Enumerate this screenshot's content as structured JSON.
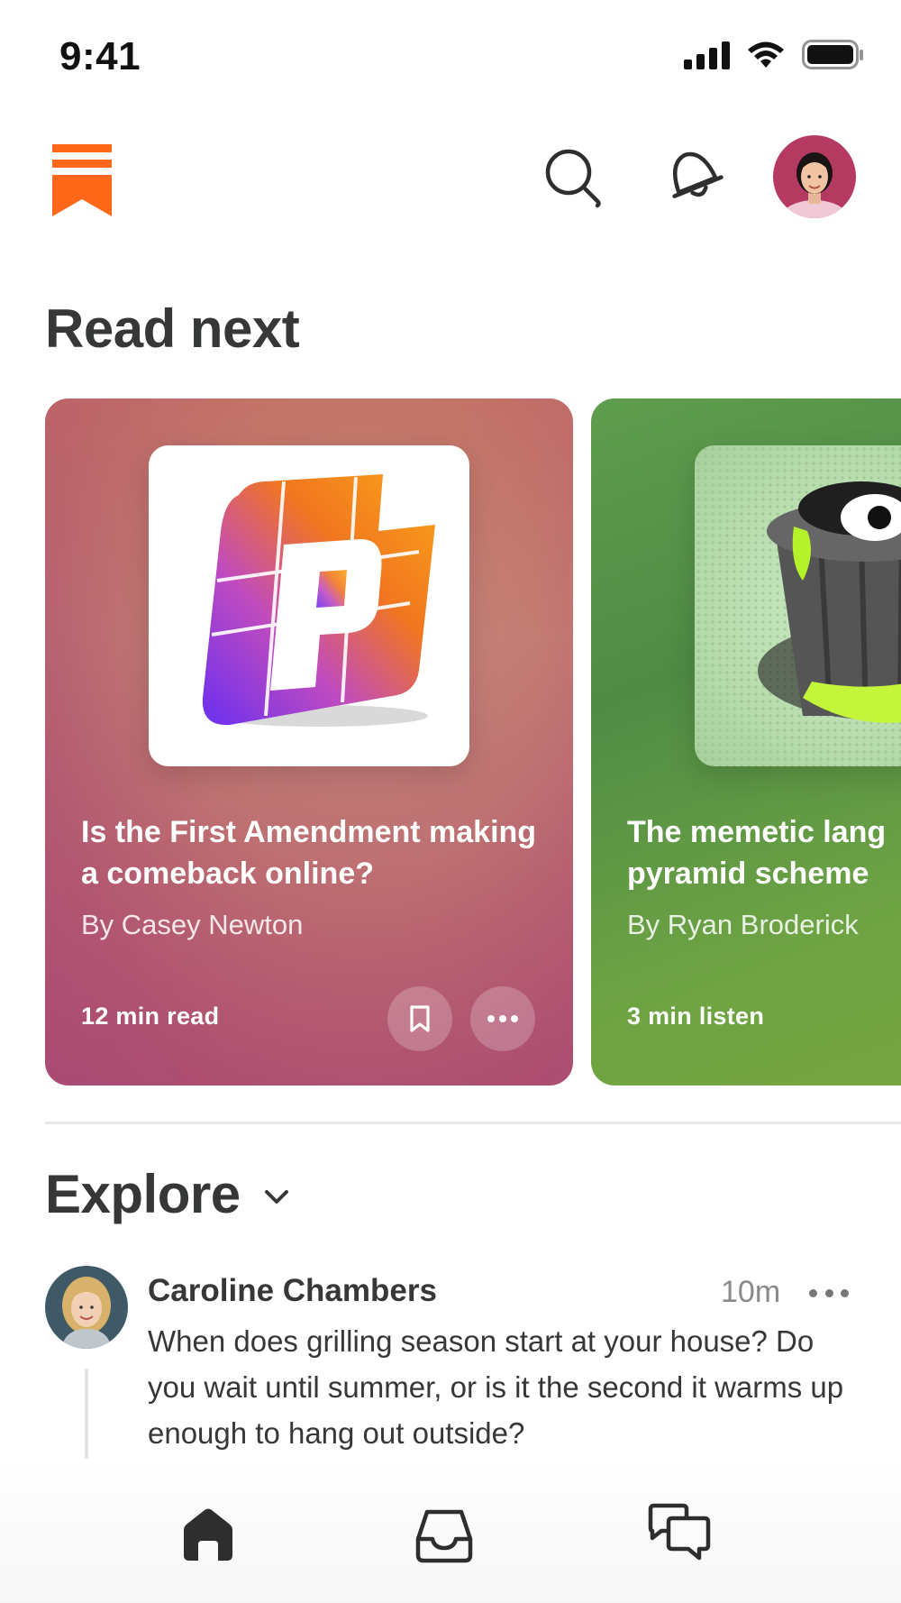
{
  "status_bar": {
    "time": "9:41"
  },
  "header": {
    "logo_icon": "substack-bookmark-logo",
    "search_icon": "search-icon",
    "activity_icon": "bell-icon",
    "profile_avatar": "user-avatar"
  },
  "read_next": {
    "title": "Read next",
    "cards": [
      {
        "title": "Is the First Amendment making a comeback online?",
        "author": "By Casey Newton",
        "meta": "12 min read",
        "art": "platformer-logo"
      },
      {
        "title": "The memetic lang pyramid scheme",
        "author": "By Ryan Broderick",
        "meta": "3 min listen",
        "art": "trash-can-slime-art"
      }
    ]
  },
  "explore": {
    "title": "Explore",
    "post": {
      "author": "Caroline Chambers",
      "time": "10m",
      "body": "When does grilling season start at your house? Do you wait until summer, or is it the second it warms up enough to hang out outside?"
    }
  },
  "bottom_nav": {
    "items": [
      "home-icon",
      "inbox-icon",
      "chat-icon"
    ]
  },
  "colors": {
    "brand": "#FF6719",
    "text": "#363737"
  }
}
